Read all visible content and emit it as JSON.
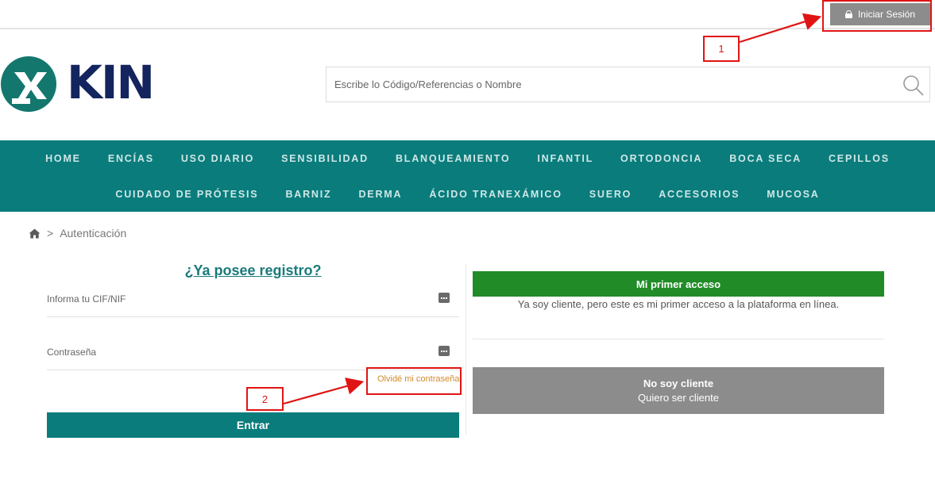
{
  "topbar": {
    "login_label": "Iniciar Sesión",
    "login_icon": "lock-icon"
  },
  "annotations": {
    "one": "1",
    "two": "2",
    "color": "#e01414"
  },
  "brand": {
    "logo_text": "KIN",
    "primary_color": "#0b7c7c",
    "logo_text_color": "#14245e"
  },
  "search": {
    "placeholder": "Escribe lo Código/Referencias o Nombre",
    "icon": "search-icon"
  },
  "nav": {
    "row1": [
      "HOME",
      "ENCÍAS",
      "USO DIARIO",
      "SENSIBILIDAD",
      "BLANQUEAMIENTO",
      "INFANTIL",
      "ORTODONCIA",
      "BOCA SECA",
      "CEPILLOS"
    ],
    "row2": [
      "CUIDADO DE PRÓTESIS",
      "BARNIZ",
      "DERMA",
      "ÁCIDO TRANEXÁMICO",
      "SUERO",
      "ACCESORIOS",
      "MUCOSA"
    ]
  },
  "breadcrumb": {
    "separator": ">",
    "current": "Autenticación"
  },
  "login_form": {
    "title": "¿Ya posee registro?",
    "cif_placeholder": "Informa tu CIF/NIF",
    "password_placeholder": "Contraseña",
    "forgot_label": "Olvidé mi contraseña",
    "submit_label": "Entrar"
  },
  "first_access": {
    "button_label": "Mi primer acceso",
    "description": "Ya soy cliente, pero este es mi primer acceso a la plataforma en línea.",
    "button_color": "#218c27"
  },
  "not_client": {
    "line1": "No soy cliente",
    "line2": "Quiero ser cliente"
  }
}
